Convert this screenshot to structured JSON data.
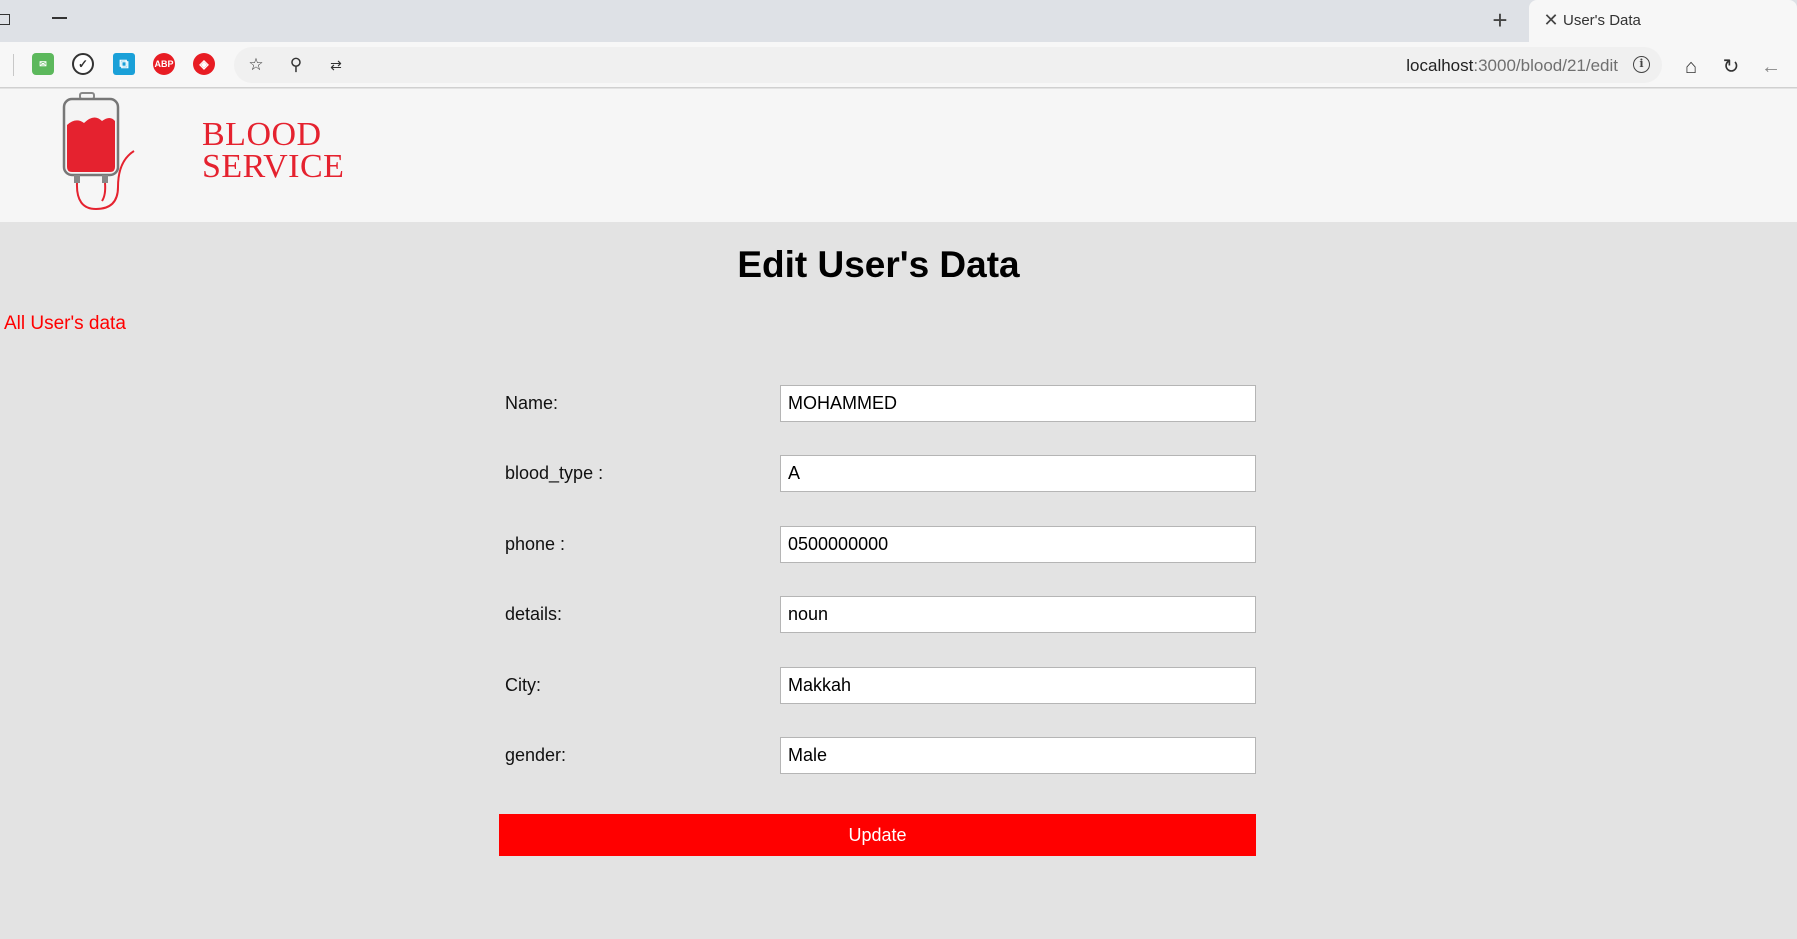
{
  "browser": {
    "tab_title": "User's Data",
    "url_host": "localhost",
    "url_path": ":3000/blood/21/edit",
    "icons": {
      "new_tab": "plus-icon",
      "tab_close": "close-icon",
      "bookmark": "star-icon",
      "zoom": "zoom-icon",
      "translate": "translate-icon",
      "info": "info-icon",
      "home": "home-icon",
      "reload": "reload-icon",
      "back": "back-arrow-icon"
    },
    "extensions": [
      {
        "name": "mail-extension-icon",
        "color": "#5cb85c"
      },
      {
        "name": "shield-extension-icon",
        "color": "#ffffff"
      },
      {
        "name": "copy-extension-icon",
        "color": "#1aa0d8"
      },
      {
        "name": "adblock-extension-icon",
        "label": "ABP",
        "color": "#e81c23"
      },
      {
        "name": "ublock-extension-icon",
        "color": "#e81c23"
      }
    ]
  },
  "header": {
    "logo_line1": "BLOOD",
    "logo_line2": "SERVICE",
    "logo_color": "#e5222f"
  },
  "main": {
    "title": "Edit User's Data",
    "back_link": "All User's data",
    "fields": [
      {
        "label": "Name:",
        "value": "MOHAMMED"
      },
      {
        "label": "blood_type :",
        "value": "A"
      },
      {
        "label": "phone :",
        "value": "0500000000"
      },
      {
        "label": "details:",
        "value": "noun"
      },
      {
        "label": "City:",
        "value": "Makkah"
      },
      {
        "label": "gender:",
        "value": "Male"
      }
    ],
    "submit_label": "Update",
    "accent_color": "#ff0000"
  }
}
